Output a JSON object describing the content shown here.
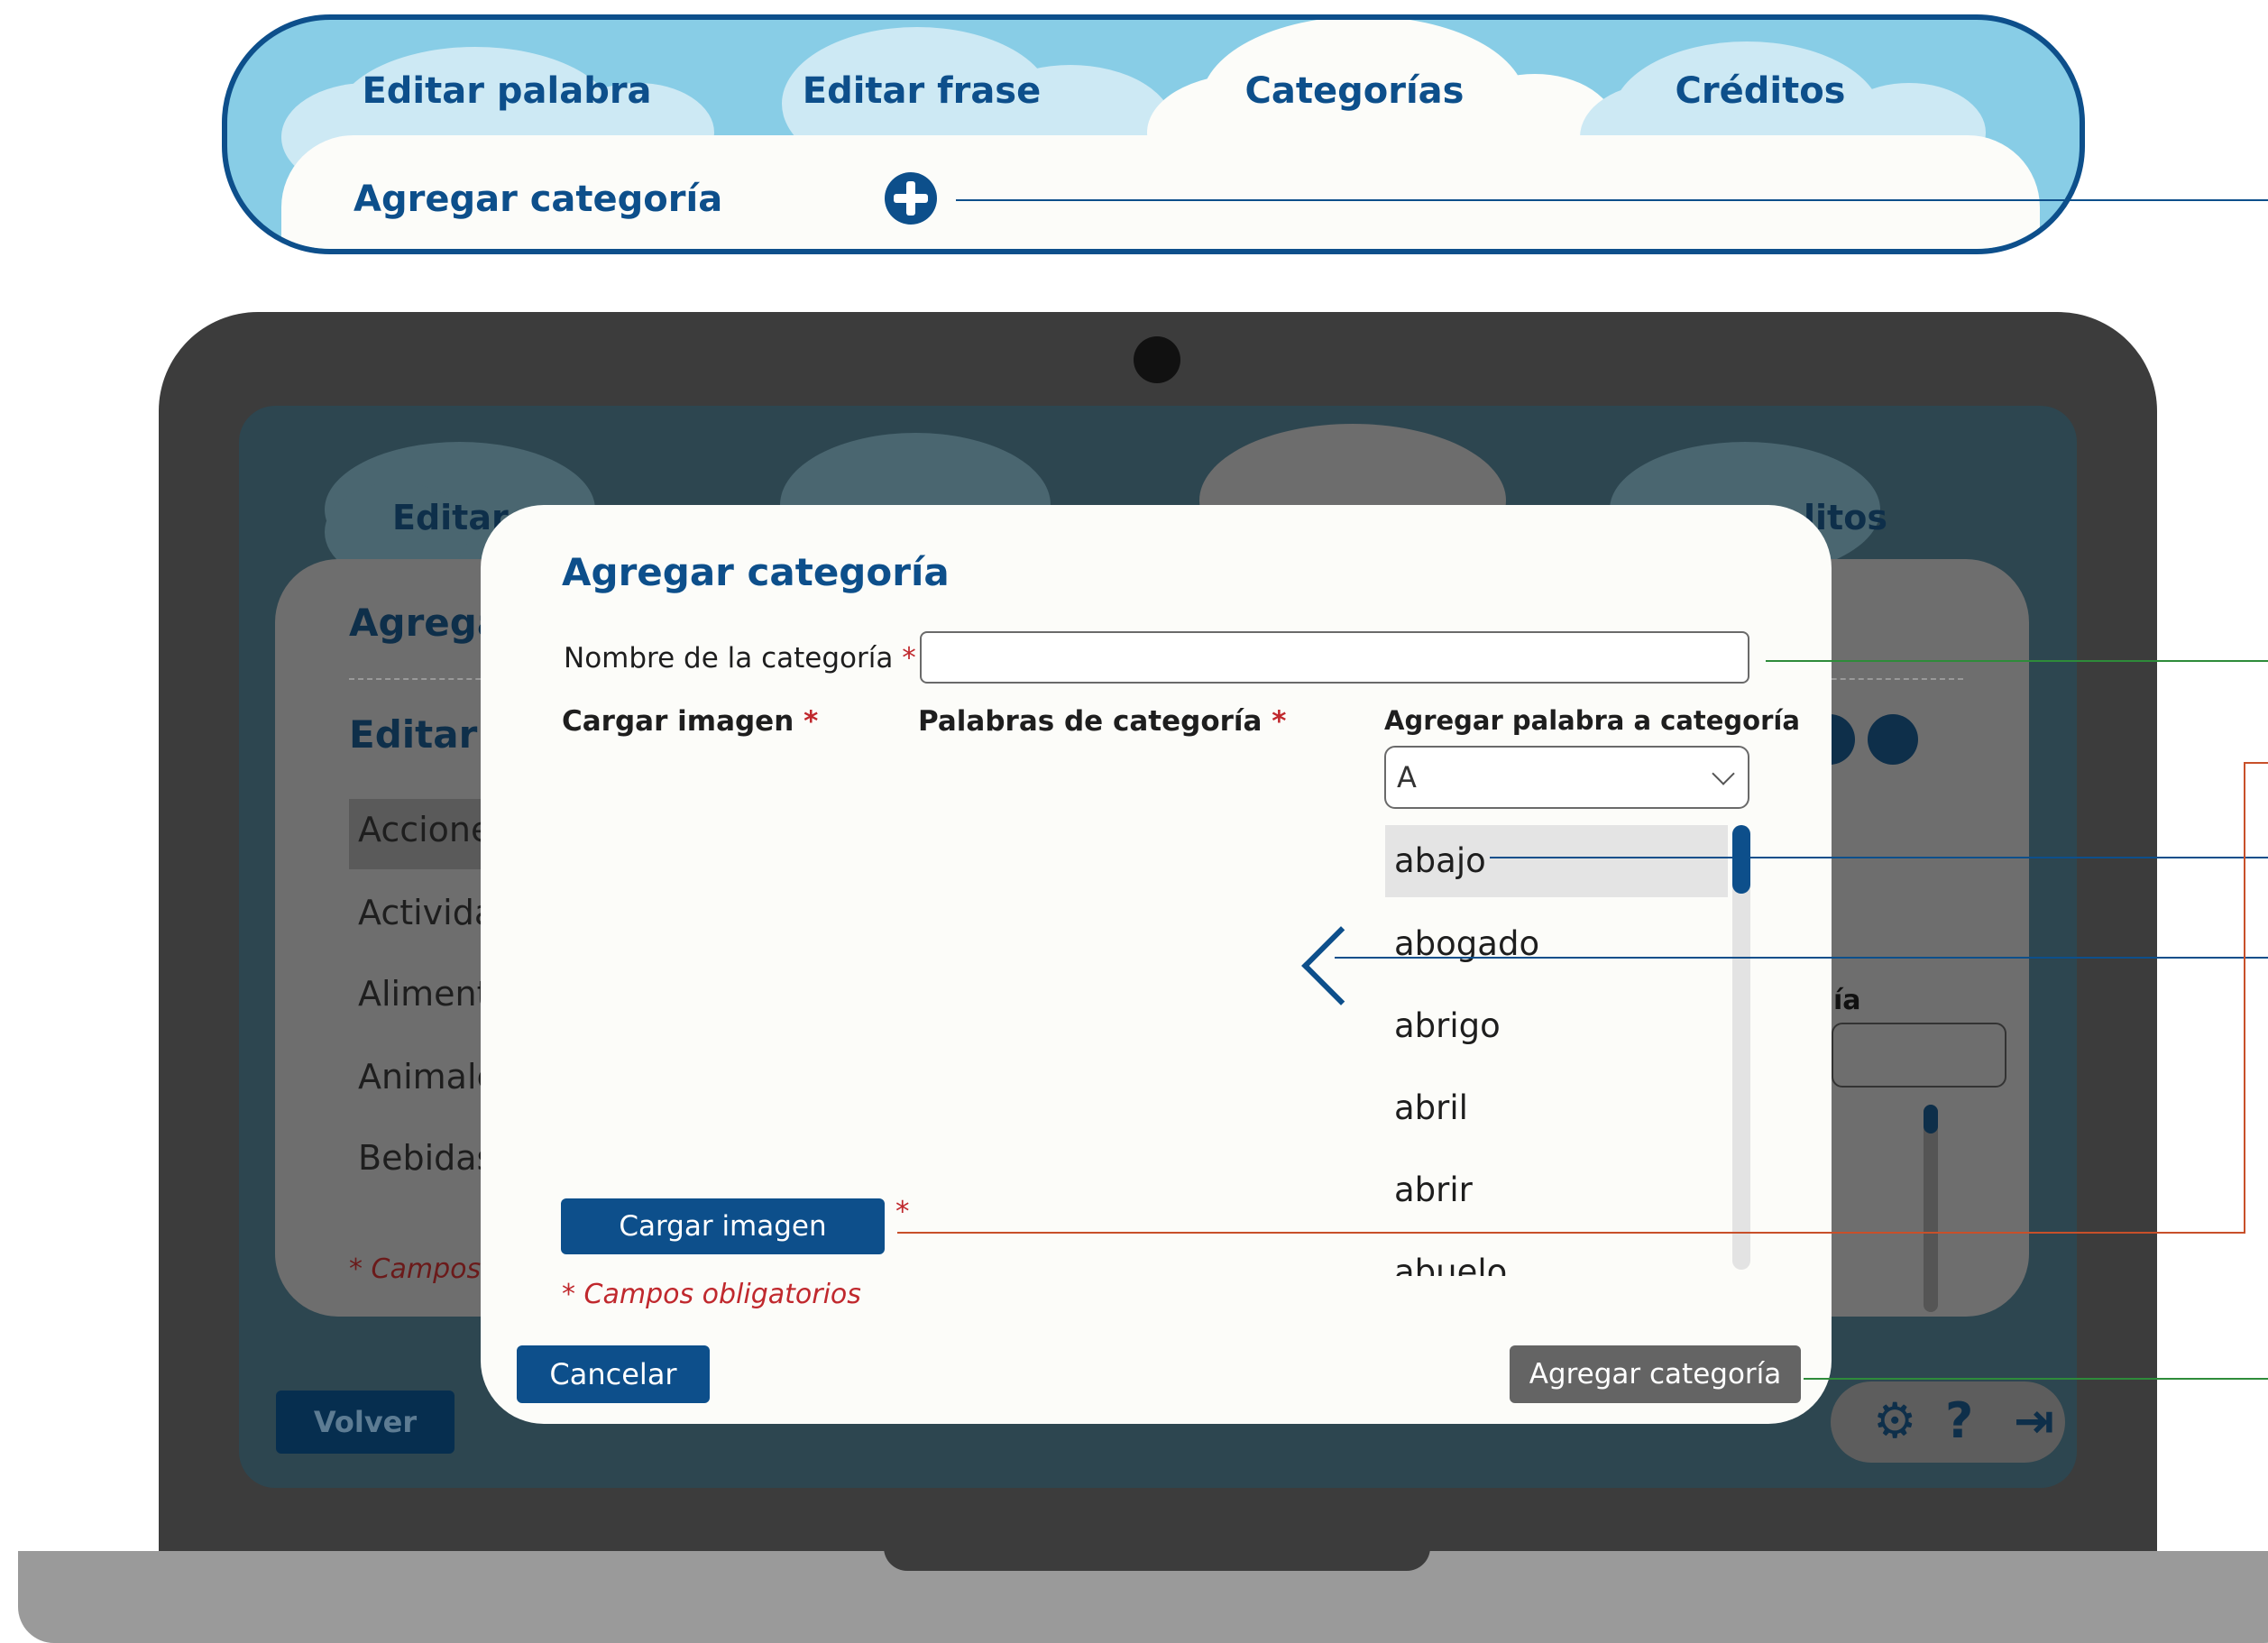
{
  "banner": {
    "tabs": [
      "Editar palabra",
      "Editar frase",
      "Categorías",
      "Créditos"
    ],
    "panel_title": "Agregar categoría",
    "add_icon": "plus-circle-icon"
  },
  "background": {
    "tabs": [
      "Editar",
      "litos"
    ],
    "add_title": "Agrega",
    "edit_title": "Editar c",
    "categories": [
      "Accione",
      "Activida",
      "Aliment",
      "Animale",
      "Bebidas"
    ],
    "note": "* Campos",
    "label_right": "ía",
    "back_button": "Volver",
    "toolbar_icons": [
      "gear-icon",
      "help-icon",
      "exit-icon"
    ]
  },
  "modal": {
    "title": "Agregar categoría",
    "name_label": "Nombre de la categoría",
    "name_value": "",
    "required_mark": "*",
    "col_image": "Cargar imagen",
    "col_words": "Palabras de categoría",
    "col_add": "Agregar palabra a categoría",
    "letter_select": "A",
    "words": [
      "abajo",
      "abogado",
      "abrigo",
      "abril",
      "abrir",
      "abuelo"
    ],
    "selected_word": "abajo",
    "upload_button": "Cargar imagen",
    "note": "* Campos obligatorios",
    "cancel_button": "Cancelar",
    "submit_button": "Agregar categoría"
  },
  "colors": {
    "primary": "#0d4f8b",
    "required": "#c0282d",
    "sky": "#88cde6",
    "disabled": "#646464"
  }
}
